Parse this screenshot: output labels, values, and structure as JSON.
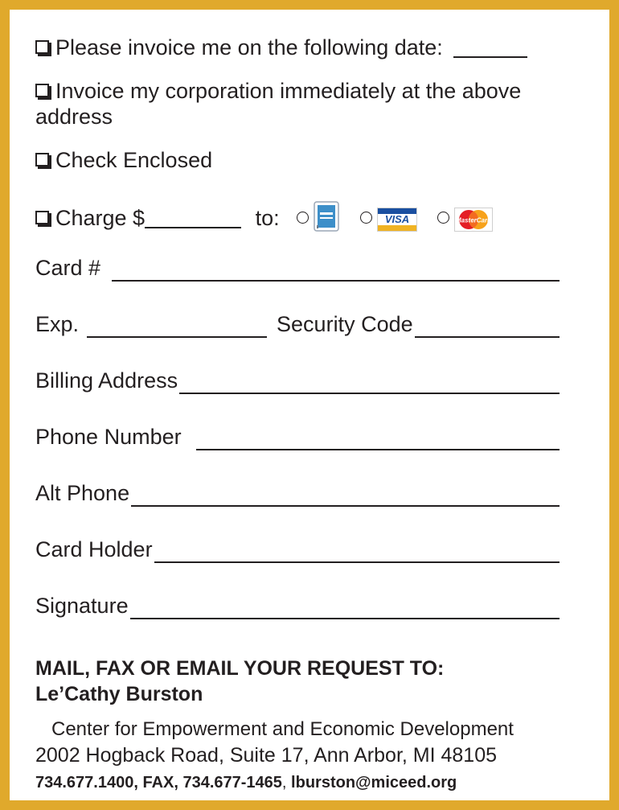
{
  "options": {
    "invoice_date": "Please invoice me on the following date:",
    "invoice_corp_line1": "Invoice my corporation immediately at the above",
    "invoice_corp_line2": "address",
    "check": "Check Enclosed",
    "charge": "Charge $",
    "charge_to": "to:"
  },
  "cards": [
    {
      "name": "American Express",
      "label": "AMERICAN EXPRESS"
    },
    {
      "name": "Visa",
      "label": "VISA"
    },
    {
      "name": "MasterCard",
      "label": "MasterCard"
    }
  ],
  "fields": {
    "card_number": "Card #",
    "exp": "Exp.",
    "security_code": "Security Code",
    "billing_address": "Billing Address",
    "phone": "Phone Number",
    "alt_phone": "Alt Phone",
    "card_holder": "Card Holder",
    "signature": "Signature"
  },
  "contact": {
    "heading": "MAIL, FAX OR EMAIL YOUR REQUEST TO:",
    "name": "Le’Cathy Burston",
    "org": "Center for Empowerment and Economic Development",
    "address": "2002 Hogback Road, Suite 17, Ann Arbor, MI 48105",
    "phone_fax": "734.677.1400, FAX, 734.677-1465",
    "separator": ",",
    "email": "lburston@miceed.org"
  },
  "colors": {
    "frame": "#e0a92c",
    "text": "#231f20"
  }
}
